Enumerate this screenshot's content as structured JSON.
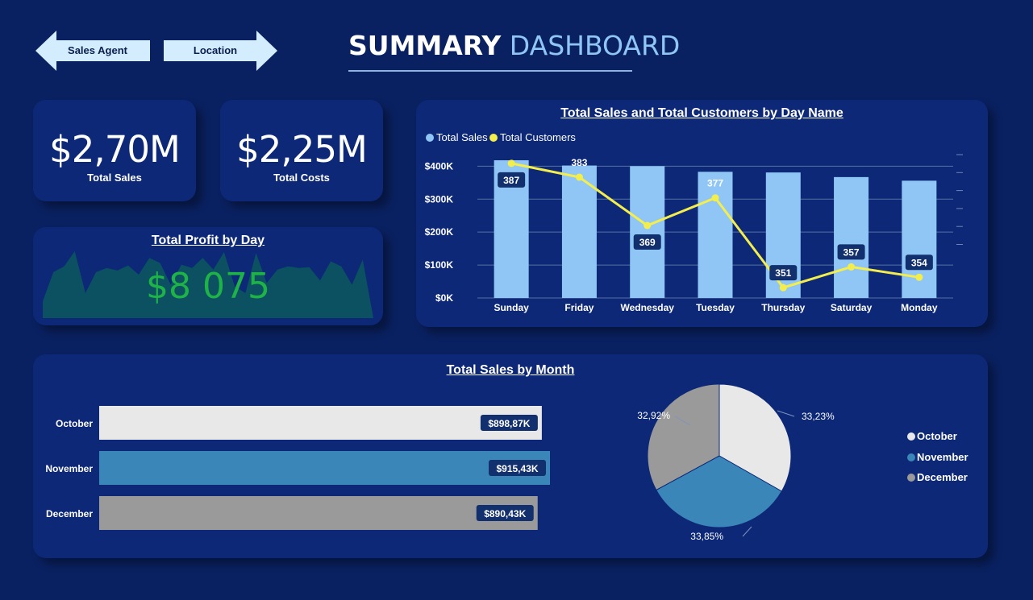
{
  "nav": {
    "sales_agent_label": "Sales Agent",
    "location_label": "Location"
  },
  "header": {
    "title_bold": "SUMMARY",
    "title_light": "DASHBOARD"
  },
  "kpis": {
    "total_sales": {
      "value": "$2,70M",
      "label": "Total Sales"
    },
    "total_costs": {
      "value": "$2,25M",
      "label": "Total Costs"
    }
  },
  "colors": {
    "background": "#0a2161",
    "card": "#0d2877",
    "sales_bar": "#8fc6f5",
    "customers_line": "#f4ee4c",
    "profit_value": "#1fb347",
    "profit_area": "#0b5162",
    "october": "#e8e8e8",
    "november": "#3a86b8",
    "december": "#9a9a9a"
  },
  "profit_card": {
    "title": "Total Profit by Day",
    "value": "$8 075"
  },
  "chart_data": [
    {
      "type": "bar",
      "title": "Total Sales and Total Customers by Day Name",
      "categories": [
        "Sunday",
        "Friday",
        "Wednesday",
        "Tuesday",
        "Thursday",
        "Saturday",
        "Monday"
      ],
      "series": [
        {
          "name": "Total Sales",
          "type": "bar",
          "values": [
            418000,
            402000,
            400000,
            383000,
            381000,
            367000,
            356000
          ]
        },
        {
          "name": "Total Customers",
          "type": "line",
          "values": [
            387,
            383,
            369,
            377,
            351,
            357,
            354
          ]
        }
      ],
      "y_ticks": [
        "$0K",
        "$100K",
        "$200K",
        "$300K",
        "$400K"
      ],
      "ylim": [
        0,
        440000
      ],
      "y2lim": [
        348,
        390
      ],
      "legend": "top-left",
      "grid": true
    },
    {
      "type": "area",
      "title": "Total Profit by Day",
      "values": [
        20,
        55,
        62,
        80,
        30,
        55,
        60,
        57,
        63,
        52,
        72,
        66,
        40,
        64,
        60,
        72,
        58,
        79,
        38,
        30,
        78,
        42,
        58,
        62,
        60,
        61,
        45,
        68,
        62,
        40,
        70,
        0
      ]
    },
    {
      "type": "bar",
      "title": "Total Sales by Month",
      "orientation": "horizontal",
      "categories": [
        "October",
        "November",
        "December"
      ],
      "values": [
        898870,
        915430,
        890430
      ],
      "labels": [
        "$898,87K",
        "$915,43K",
        "$890,43K"
      ]
    },
    {
      "type": "pie",
      "categories": [
        "October",
        "November",
        "December"
      ],
      "values": [
        33.23,
        33.85,
        32.92
      ],
      "labels": [
        "33,23%",
        "33,85%",
        "32,92%"
      ],
      "legend": "right"
    }
  ]
}
